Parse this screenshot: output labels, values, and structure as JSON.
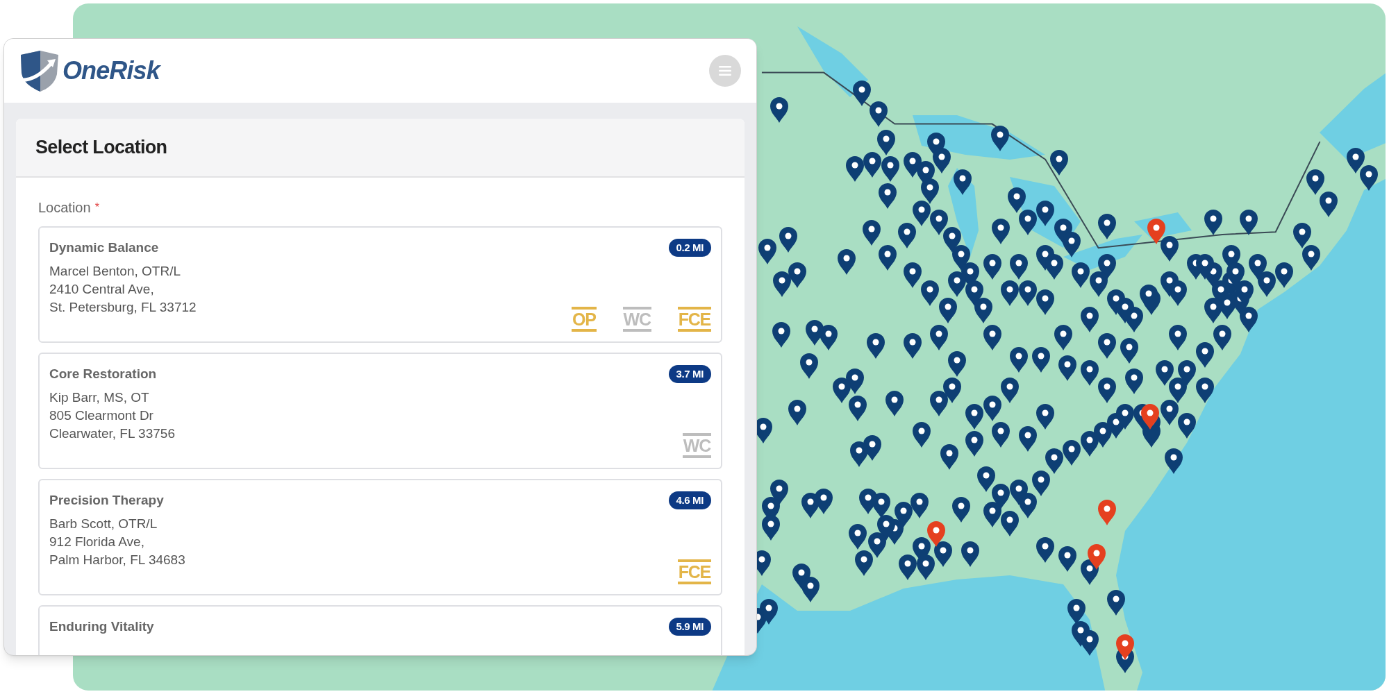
{
  "header": {
    "logo_text": "OneRisk"
  },
  "panel": {
    "title": "Select Location",
    "field_label": "Location",
    "required_mark": "*"
  },
  "locations": [
    {
      "name": "Dynamic Balance",
      "distance": "0.2 MI",
      "lines": [
        "Marcel Benton, OTR/L",
        "2410 Central Ave,",
        "St. Petersburg, FL 33712"
      ],
      "tags": [
        {
          "label": "OP",
          "color": "#e3b548"
        },
        {
          "label": "WC",
          "color": "#bdbdbd"
        },
        {
          "label": "FCE",
          "color": "#e3b548"
        }
      ]
    },
    {
      "name": "Core Restoration",
      "distance": "3.7 MI",
      "lines": [
        "Kip Barr, MS, OT",
        "805 Clearmont Dr",
        "Clearwater, FL 33756"
      ],
      "tags": [
        {
          "label": "WC",
          "color": "#bdbdbd"
        }
      ]
    },
    {
      "name": "Precision Therapy",
      "distance": "4.6 MI",
      "lines": [
        "Barb Scott, OTR/L",
        "912 Florida Ave,",
        "Palm Harbor, FL 34683"
      ],
      "tags": [
        {
          "label": "FCE",
          "color": "#e3b548"
        }
      ]
    },
    {
      "name": "Enduring Vitality",
      "distance": "5.9 MI"
    }
  ]
}
